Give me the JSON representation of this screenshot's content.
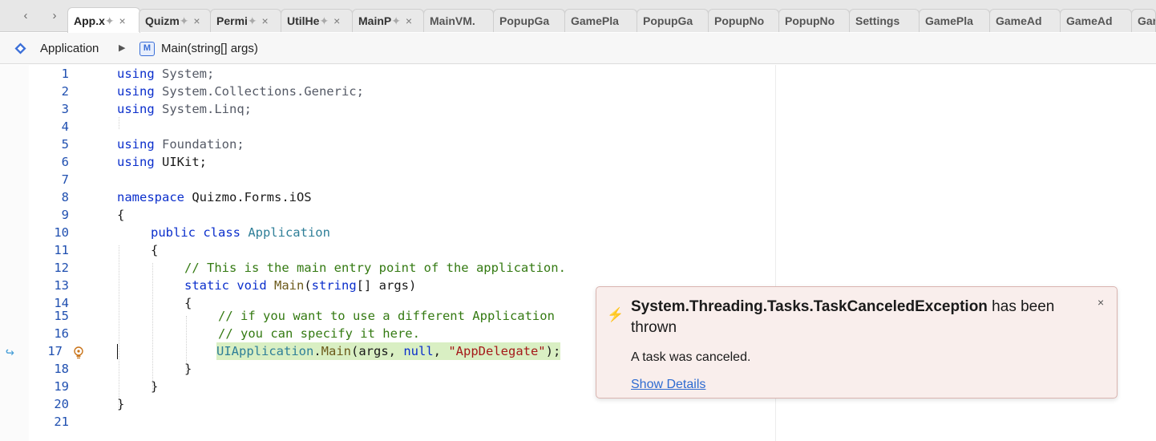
{
  "tabs": [
    {
      "label": "App.x",
      "pin": "✦",
      "close": "×"
    },
    {
      "label": "Quizm",
      "pin": "✦",
      "close": "×"
    },
    {
      "label": "Permi",
      "pin": "✦",
      "close": "×"
    },
    {
      "label": "UtilHe",
      "pin": "✦",
      "close": "×"
    },
    {
      "label": "MainP",
      "pin": "✦",
      "close": "×"
    },
    {
      "label": "MainVM."
    },
    {
      "label": "PopupGa"
    },
    {
      "label": "GamePla"
    },
    {
      "label": "PopupGa"
    },
    {
      "label": "PopupNo"
    },
    {
      "label": "PopupNo"
    },
    {
      "label": "Settings"
    },
    {
      "label": "GamePla"
    },
    {
      "label": "GameAd"
    },
    {
      "label": "GameAd"
    },
    {
      "label": "Gar"
    }
  ],
  "nav": {
    "back": "‹",
    "forward": "›"
  },
  "breadcrumb": {
    "class_name": "Application",
    "separator": "▶",
    "method_badge": "M",
    "method_name": "Main(string[] args)"
  },
  "editor": {
    "line_numbers": [
      "1",
      "2",
      "3",
      "4",
      "5",
      "6",
      "7",
      "8",
      "9",
      "10",
      "11",
      "12",
      "13",
      "14",
      "15",
      "16",
      "17",
      "18",
      "19",
      "20",
      "21"
    ],
    "lines": {
      "l1_kw": "using",
      "l1_ns": " System;",
      "l2_kw": "using",
      "l2_ns": " System.Collections.Generic;",
      "l3_kw": "using",
      "l3_ns": " System.Linq;",
      "l5_kw": "using",
      "l5_ns": " Foundation;",
      "l6_kw": "using",
      "l6_rest": " UIKit;",
      "l8_kw": "namespace",
      "l8_rest": " Quizmo.Forms.iOS",
      "l9": "{",
      "l10_kw": "public class",
      "l10_type": " Application",
      "l11": "{",
      "l12_cm": "// This is the main entry point of the application.",
      "l13_kw": "static void",
      "l13_meth": " Main",
      "l13_a": "(",
      "l13_kw2": "string",
      "l13_b": "[] args)",
      "l14": "{",
      "l15_cm": "// if you want to use a different Application",
      "l16_cm": "// you can specify it here.",
      "l17_type": "UIApplication",
      "l17_a": ".",
      "l17_meth": "Main",
      "l17_b": "(args, ",
      "l17_kw": "null",
      "l17_c": ", ",
      "l17_str": "\"AppDelegate\"",
      "l17_d": ");",
      "l18": "}",
      "l19": "}",
      "l20": "}"
    },
    "current_line_marker": "↪"
  },
  "exception_popup": {
    "title_bold": "System.Threading.Tasks.TaskCanceledException",
    "title_rest": " has been thrown",
    "message": "A task was canceled.",
    "link": "Show Details",
    "close": "×",
    "icon": "⚡"
  },
  "colors": {
    "keyword": "#0b2fcc",
    "comment": "#347a12",
    "string": "#a51a1a",
    "type": "#2f7f98",
    "highlight": "#d9efc3",
    "popup_bg": "#f9eeec",
    "link": "#2e6bd1"
  },
  "icons": {
    "class": "class-diamond-icon",
    "method": "method-icon",
    "bulb": "lightbulb-icon",
    "exception": "lightning-icon"
  }
}
